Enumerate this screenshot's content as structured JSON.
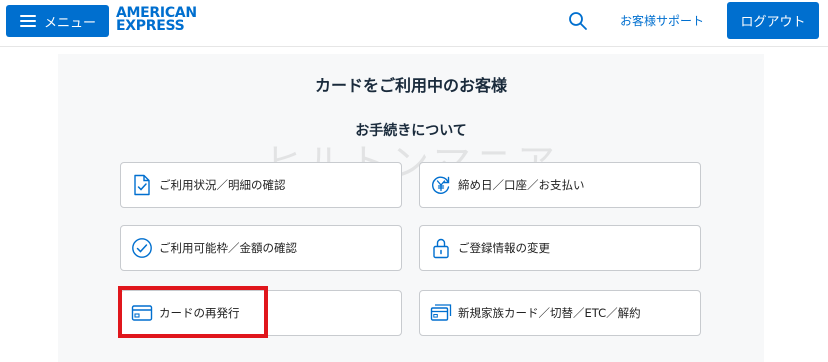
{
  "header": {
    "menu_label": "メニュー",
    "logo_line1": "AMERICAN",
    "logo_line2": "EXPRESS",
    "support_link": "お客様サポート",
    "logout_label": "ログアウト"
  },
  "main": {
    "page_title": "カードをご利用中のお客様",
    "section_title": "お手続きについて",
    "watermark": "ヒルトンマニア",
    "tiles": [
      {
        "label": "ご利用状況／明細の確認",
        "icon": "document-check-icon"
      },
      {
        "label": "締め日／口座／お支払い",
        "icon": "yen-cycle-icon"
      },
      {
        "label": "ご利用可能枠／金額の確認",
        "icon": "check-circle-icon"
      },
      {
        "label": "ご登録情報の変更",
        "icon": "lock-icon"
      },
      {
        "label": "カードの再発行",
        "icon": "card-icon"
      },
      {
        "label": "新規家族カード／切替／ETC／解約",
        "icon": "cards-stack-icon"
      }
    ]
  },
  "colors": {
    "brand_blue": "#006fcf",
    "highlight_red": "#e0161c",
    "panel_bg": "#f7f8f9"
  }
}
